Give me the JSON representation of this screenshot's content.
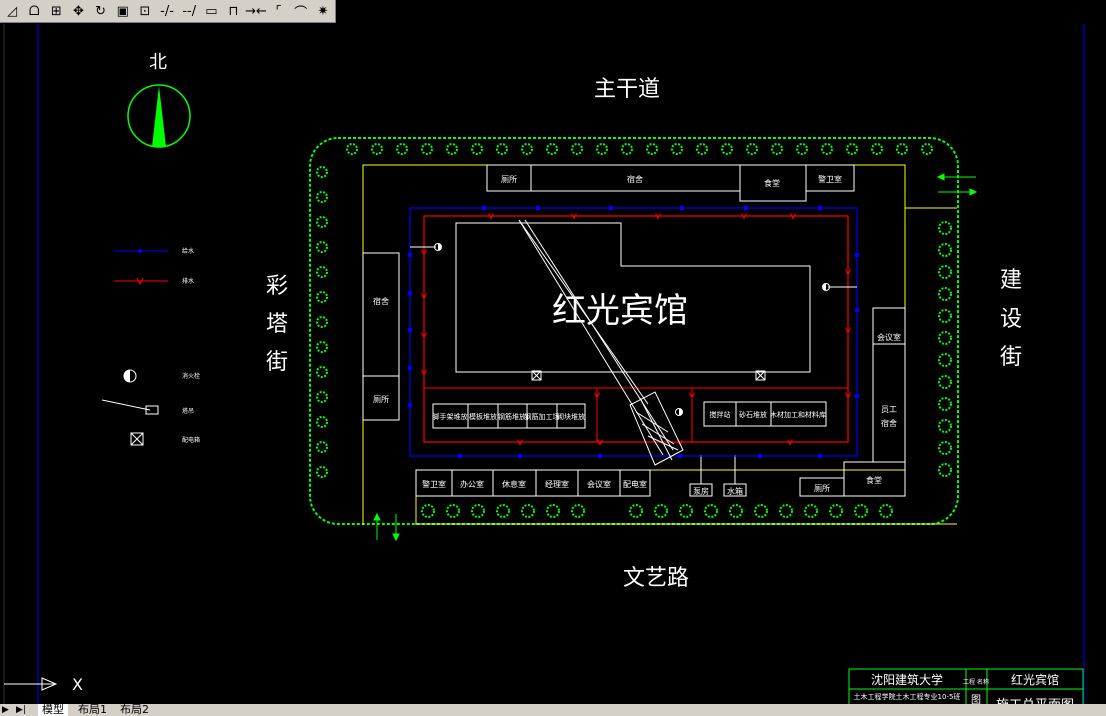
{
  "toolbar": {
    "buttons": [
      {
        "name": "draw-order-icon",
        "glyph": "◿"
      },
      {
        "name": "text-style-icon",
        "glyph": "ᗝ"
      },
      {
        "name": "block-icon",
        "glyph": "⊞"
      },
      {
        "name": "move-icon",
        "glyph": "✥"
      },
      {
        "name": "rotate-icon",
        "glyph": "↻"
      },
      {
        "name": "scale-icon",
        "glyph": "▣"
      },
      {
        "name": "stretch-icon",
        "glyph": "⊡"
      },
      {
        "name": "trim-icon",
        "glyph": "-/-"
      },
      {
        "name": "extend-icon",
        "glyph": "--/"
      },
      {
        "name": "break-icon",
        "glyph": "▭"
      },
      {
        "name": "break-at-point-icon",
        "glyph": "⊓"
      },
      {
        "name": "join-icon",
        "glyph": "→←"
      },
      {
        "name": "chamfer-icon",
        "glyph": "⌜"
      },
      {
        "name": "fillet-icon",
        "glyph": "⌒"
      },
      {
        "name": "explode-icon",
        "glyph": "✷"
      }
    ]
  },
  "drawing": {
    "north_label": "北",
    "road_top": "主干道",
    "road_bottom": "文艺路",
    "road_left": [
      "彩",
      "塔",
      "街"
    ],
    "road_right": [
      "建",
      "设",
      "街"
    ],
    "building_name": "红光宾馆",
    "top_rooms": [
      "厕所",
      "宿舍",
      "食堂",
      "警卫室"
    ],
    "left_rooms": [
      "宿舍",
      "厕所"
    ],
    "right_rooms": [
      "会议室",
      "员工",
      "宿舍"
    ],
    "bottom_rooms": [
      "警卫室",
      "办公室",
      "休息室",
      "经理室",
      "会议室",
      "配电室"
    ],
    "bottom_right_rooms": [
      "厕所",
      "食堂"
    ],
    "bottom_small": [
      "泵房",
      "水箱"
    ],
    "yard_left": [
      "脚手架堆放",
      "模板堆放",
      "钢筋堆放",
      "钢筋加工场",
      "砌块堆放"
    ],
    "yard_right": [
      "搅拌站",
      "砂石堆放",
      "木材加工和材料库"
    ],
    "legend": [
      "给水",
      "排水",
      "消火栓",
      "塔吊",
      "配电箱"
    ]
  },
  "title_block": {
    "school": "沈阳建筑大学",
    "class": "土木工程学院土木工程专业10-5班",
    "project_label": "工程\n名称",
    "project_name": "红光宾馆",
    "drawing_title": "施工总平面图",
    "tu": "图"
  },
  "ucs_label": "X",
  "tabs": [
    "模型",
    "布局1",
    "布局2"
  ],
  "colors": {
    "fence": "#00ff00",
    "boundary": "#ffff00",
    "building": "#ffffff",
    "water_supply": "#0000ff",
    "drainage": "#ff0000",
    "frame": "#0000ff"
  }
}
